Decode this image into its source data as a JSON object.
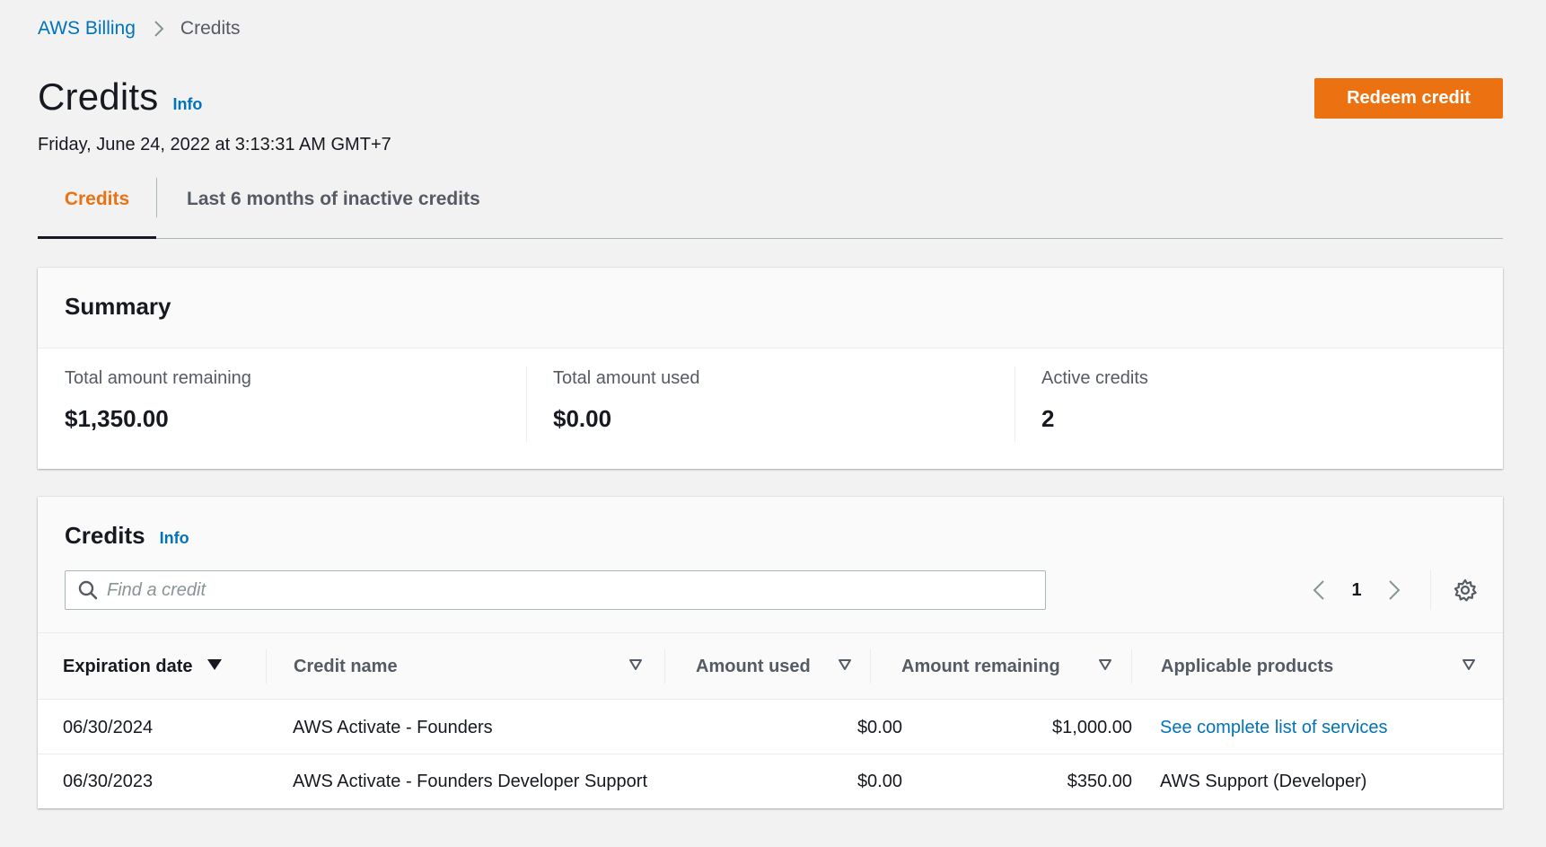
{
  "breadcrumb": {
    "parent": "AWS Billing",
    "current": "Credits"
  },
  "header": {
    "title": "Credits",
    "info_label": "Info",
    "timestamp": "Friday, June 24, 2022 at 3:13:31 AM GMT+7",
    "redeem_label": "Redeem credit"
  },
  "tabs": [
    {
      "label": "Credits",
      "active": true
    },
    {
      "label": "Last 6 months of inactive credits",
      "active": false
    }
  ],
  "summary": {
    "title": "Summary",
    "stats": [
      {
        "label": "Total amount remaining",
        "value": "$1,350.00"
      },
      {
        "label": "Total amount used",
        "value": "$0.00"
      },
      {
        "label": "Active credits",
        "value": "2"
      }
    ]
  },
  "credits_table": {
    "title": "Credits",
    "info_label": "Info",
    "search_placeholder": "Find a credit",
    "search_value": "",
    "current_page": "1",
    "columns": [
      {
        "label": "Expiration date",
        "sorted": "descending"
      },
      {
        "label": "Credit name",
        "sorted": "none"
      },
      {
        "label": "Amount used",
        "sorted": "none"
      },
      {
        "label": "Amount remaining",
        "sorted": "none"
      },
      {
        "label": "Applicable products",
        "sorted": "none"
      }
    ],
    "rows": [
      {
        "expiration_date": "06/30/2024",
        "credit_name": "AWS Activate - Founders",
        "amount_used": "$0.00",
        "amount_remaining": "$1,000.00",
        "applicable_products": "See complete list of services",
        "products_is_link": true
      },
      {
        "expiration_date": "06/30/2023",
        "credit_name": "AWS Activate - Founders Developer Support",
        "amount_used": "$0.00",
        "amount_remaining": "$350.00",
        "applicable_products": "AWS Support (Developer)",
        "products_is_link": false
      }
    ]
  },
  "icons": {
    "breadcrumb_separator": "chevron-right-icon",
    "search": "search-icon",
    "prev_page": "chevron-left-icon",
    "next_page": "chevron-right-icon",
    "settings": "gear-icon",
    "sort_desc": "sort-descending-icon",
    "sort_none": "sort-icon"
  },
  "colors": {
    "accent": "#ec7211",
    "link": "#0073bb",
    "text": "#16191f",
    "muted_text": "#545b64",
    "background": "#f2f2f2"
  }
}
